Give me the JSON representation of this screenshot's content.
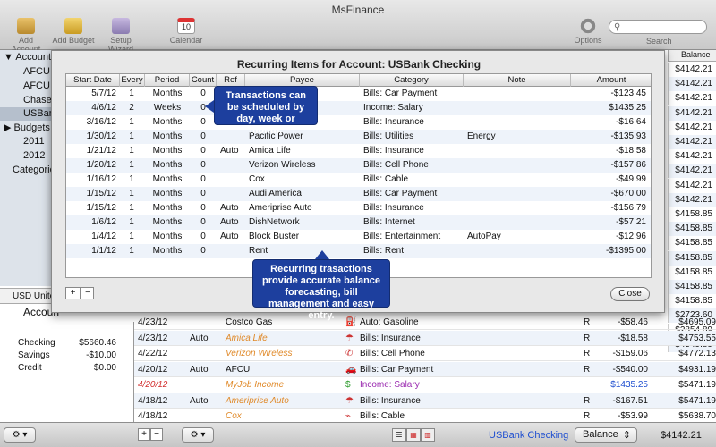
{
  "app": {
    "title": "MsFinance"
  },
  "toolbar": {
    "add_account": "Add Account",
    "add_budget": "Add Budget",
    "setup_wizard": "Setup Wizard",
    "calendar": "Calendar",
    "calendar_day": "10",
    "options": "Options",
    "search": "Search"
  },
  "sidebar": {
    "accounts_header": "Accounts",
    "accounts": [
      "AFCU C",
      "AFCU S",
      "Chase",
      "USBan"
    ],
    "budgets_header": "Budgets",
    "budgets": [
      "2011",
      "2012"
    ],
    "categories": "Categories",
    "currency": "USD Unite",
    "accounts_heading": "Accoun",
    "summary": [
      {
        "label": "Checking",
        "value": "$5660.46"
      },
      {
        "label": "Savings",
        "value": "-$10.00"
      },
      {
        "label": "Credit",
        "value": "$0.00"
      }
    ]
  },
  "balance_column": {
    "header": "Balance",
    "values": [
      "$4142.21",
      "$4142.21",
      "$4142.21",
      "$4142.21",
      "$4142.21",
      "$4142.21",
      "$4142.21",
      "$4142.21",
      "$4142.21",
      "$4142.21",
      "$4158.85",
      "$4158.85",
      "$4158.85",
      "$4158.85",
      "$4158.85",
      "$4158.85",
      "$4158.85",
      "$2723.60",
      "$2854.89",
      "$4549.89"
    ]
  },
  "dialog": {
    "title": "Recurring Items for Account: USBank Checking",
    "columns": [
      "Start Date",
      "Every",
      "Period",
      "Count",
      "Ref",
      "Payee",
      "Category",
      "Note",
      "Amount"
    ],
    "rows": [
      {
        "date": "5/7/12",
        "every": "1",
        "period": "Months",
        "count": "0",
        "ref": "",
        "payee": "",
        "category": "Bills: Car Payment",
        "note": "",
        "amount": "-$123.45"
      },
      {
        "date": "4/6/12",
        "every": "2",
        "period": "Weeks",
        "count": "0",
        "ref": "",
        "payee": "",
        "category": "Income: Salary",
        "note": "",
        "amount": "$1435.25"
      },
      {
        "date": "3/16/12",
        "every": "1",
        "period": "Months",
        "count": "0",
        "ref": "",
        "payee": "Insurance",
        "category": "Bills: Insurance",
        "note": "",
        "amount": "-$16.64"
      },
      {
        "date": "1/30/12",
        "every": "1",
        "period": "Months",
        "count": "0",
        "ref": "",
        "payee": "Pacific Power",
        "category": "Bills: Utilities",
        "note": "Energy",
        "amount": "-$135.93"
      },
      {
        "date": "1/21/12",
        "every": "1",
        "period": "Months",
        "count": "0",
        "ref": "Auto",
        "payee": "Amica Life",
        "category": "Bills: Insurance",
        "note": "",
        "amount": "-$18.58"
      },
      {
        "date": "1/20/12",
        "every": "1",
        "period": "Months",
        "count": "0",
        "ref": "",
        "payee": "Verizon Wireless",
        "category": "Bills: Cell Phone",
        "note": "",
        "amount": "-$157.86"
      },
      {
        "date": "1/16/12",
        "every": "1",
        "period": "Months",
        "count": "0",
        "ref": "",
        "payee": "Cox",
        "category": "Bills: Cable",
        "note": "",
        "amount": "-$49.99"
      },
      {
        "date": "1/15/12",
        "every": "1",
        "period": "Months",
        "count": "0",
        "ref": "",
        "payee": "Audi America",
        "category": "Bills: Car Payment",
        "note": "",
        "amount": "-$670.00"
      },
      {
        "date": "1/15/12",
        "every": "1",
        "period": "Months",
        "count": "0",
        "ref": "Auto",
        "payee": "Ameriprise Auto",
        "category": "Bills: Insurance",
        "note": "",
        "amount": "-$156.79"
      },
      {
        "date": "1/6/12",
        "every": "1",
        "period": "Months",
        "count": "0",
        "ref": "Auto",
        "payee": "DishNetwork",
        "category": "Bills: Internet",
        "note": "",
        "amount": "-$57.21"
      },
      {
        "date": "1/4/12",
        "every": "1",
        "period": "Months",
        "count": "0",
        "ref": "Auto",
        "payee": "Block Buster",
        "category": "Bills: Entertainment",
        "note": "AutoPay",
        "amount": "-$12.96"
      },
      {
        "date": "1/1/12",
        "every": "1",
        "period": "Months",
        "count": "0",
        "ref": "",
        "payee": "Rent",
        "category": "Bills: Rent",
        "note": "",
        "amount": "-$1395.00"
      }
    ],
    "add_label": "+",
    "remove_label": "−",
    "close_label": "Close"
  },
  "callouts": {
    "schedule": "Transactions can be scheduled by day, week or month.",
    "forecast": "Recurring trasactions provide accurate balance forecasting, bill management and easy entry."
  },
  "register": {
    "rows": [
      {
        "date": "4/23/12",
        "ref": "",
        "payee": "Costco Gas",
        "payee_style": "",
        "category": "Auto: Gasoline",
        "icon": "gas-pump-icon",
        "status": "R",
        "amount": "-$58.46",
        "balance": "$4695.09"
      },
      {
        "date": "4/23/12",
        "ref": "Auto",
        "payee": "Amica Life",
        "payee_style": "orange",
        "category": "Bills: Insurance",
        "icon": "umbrella-icon",
        "status": "R",
        "amount": "-$18.58",
        "balance": "$4753.55"
      },
      {
        "date": "4/22/12",
        "ref": "",
        "payee": "Verizon Wireless",
        "payee_style": "orange",
        "category": "Bills: Cell Phone",
        "icon": "phone-icon",
        "status": "R",
        "amount": "-$159.06",
        "balance": "$4772.13"
      },
      {
        "date": "4/20/12",
        "ref": "Auto",
        "payee": "AFCU",
        "payee_style": "",
        "category": "Bills: Car Payment",
        "icon": "car-icon",
        "status": "R",
        "amount": "-$540.00",
        "balance": "$4931.19"
      },
      {
        "date": "4/20/12",
        "ref": "",
        "payee": "MyJob Income",
        "payee_style": "orange",
        "category": "Income: Salary",
        "icon": "dollar-icon",
        "status": "",
        "amount": "$1435.25",
        "balance": "$5471.19"
      },
      {
        "date": "4/18/12",
        "ref": "Auto",
        "payee": "Ameriprise Auto",
        "payee_style": "orange",
        "category": "Bills: Insurance",
        "icon": "umbrella-icon",
        "status": "R",
        "amount": "-$167.51",
        "balance": "$5471.19"
      },
      {
        "date": "4/18/12",
        "ref": "",
        "payee": "Cox",
        "payee_style": "orange",
        "category": "Bills: Cable",
        "icon": "cable-icon",
        "status": "R",
        "amount": "-$53.99",
        "balance": "$5638.70"
      }
    ]
  },
  "statusbar": {
    "account": "USBank Checking",
    "balance_mode": "Balance",
    "amount": "$4142.21",
    "add": "+",
    "remove": "−"
  },
  "colors": {
    "callout": "#1d3f9e",
    "link_blue": "#1f4fd0",
    "scheduled_orange": "#e08a2a"
  }
}
